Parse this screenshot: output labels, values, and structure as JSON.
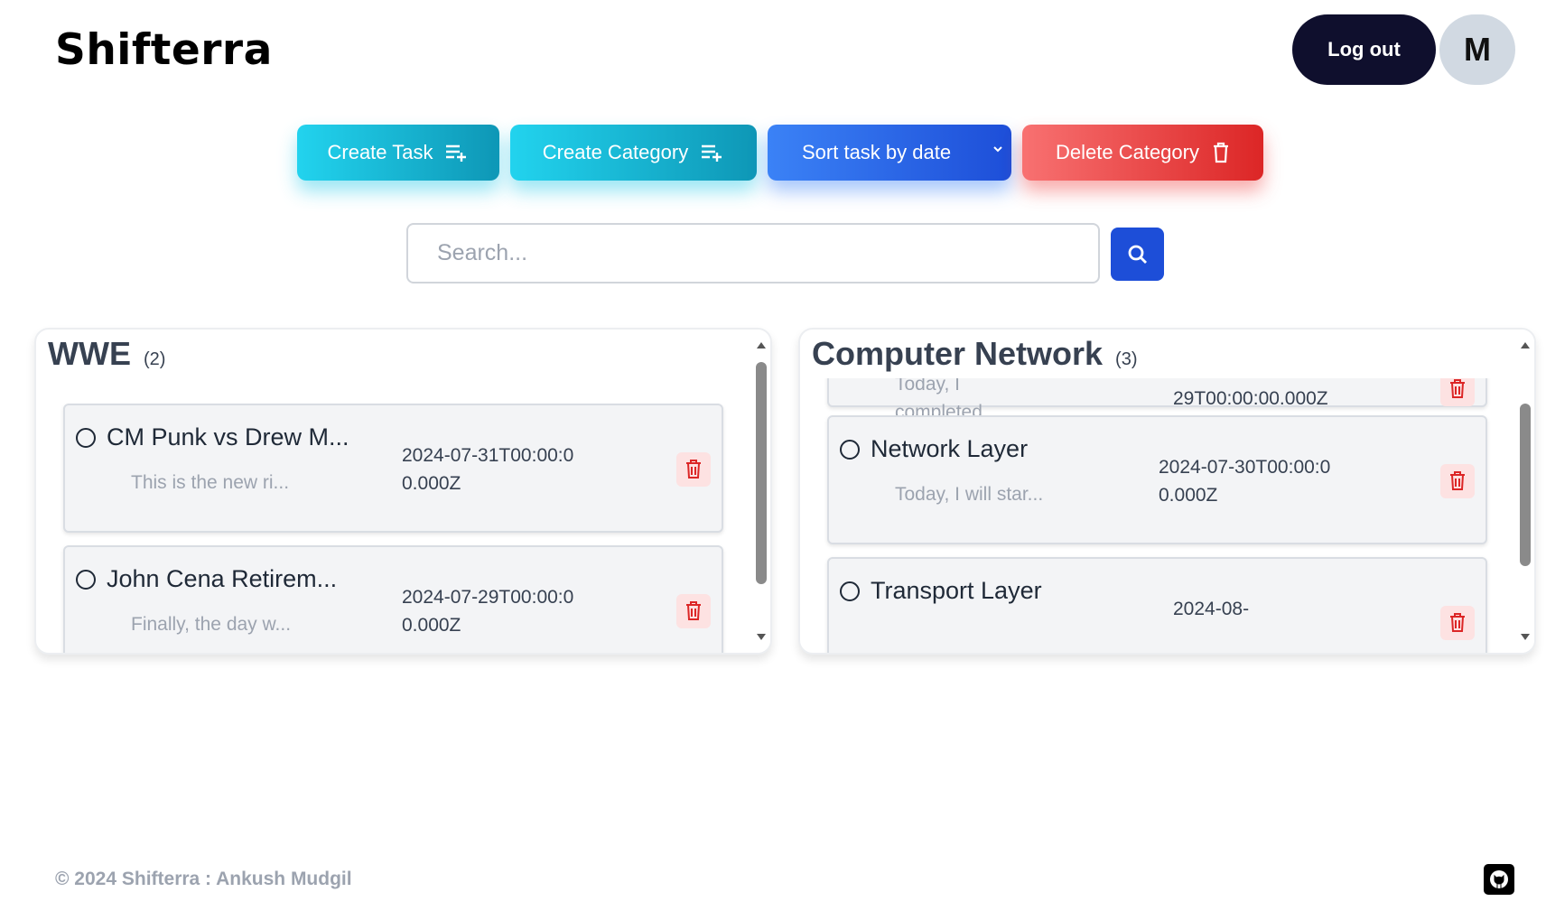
{
  "brand": "Shifterra",
  "header": {
    "logout_label": "Log out",
    "avatar_initial": "M"
  },
  "toolbar": {
    "create_task": "Create Task",
    "create_category": "Create Category",
    "sort_label": "Sort task by date",
    "delete_category": "Delete Category"
  },
  "search": {
    "placeholder": "Search..."
  },
  "categories": [
    {
      "name": "WWE",
      "count": "(2)",
      "tasks": [
        {
          "title": "CM Punk vs Drew M...",
          "description": "This is the new ri...",
          "date": "2024-07-31T00:00:00.000Z"
        },
        {
          "title": "John Cena Retirem...",
          "description": "Finally, the day w...",
          "date": "2024-07-29T00:00:00.000Z"
        }
      ]
    },
    {
      "name": "Computer Network",
      "count": "(3)",
      "tasks": [
        {
          "title": "",
          "description": "Today, I completed...",
          "date": "29T00:00:00.000Z"
        },
        {
          "title": "Network Layer",
          "description": "Today, I will star...",
          "date": "2024-07-30T00:00:00.000Z"
        },
        {
          "title": "Transport Layer",
          "description": "",
          "date": "2024-08-"
        }
      ]
    }
  ],
  "footer": {
    "copyright": "© 2024 Shifterra : Ankush Mudgil"
  },
  "icons": {
    "create_task": "playlist-add-icon",
    "create_category": "playlist-add-icon",
    "sort": "chevron-down-icon",
    "delete_category": "trash-icon",
    "search": "search-icon",
    "task_trash": "trash-icon",
    "task_status": "circle-icon",
    "footer": "github-icon"
  },
  "colors": {
    "cyan_button": "#22d3ee",
    "blue_button": "#3b82f6",
    "red_button": "#ef4444",
    "search_button": "#1d4ed8",
    "logout": "#0f0f2d",
    "avatar": "#d1d9e2"
  }
}
